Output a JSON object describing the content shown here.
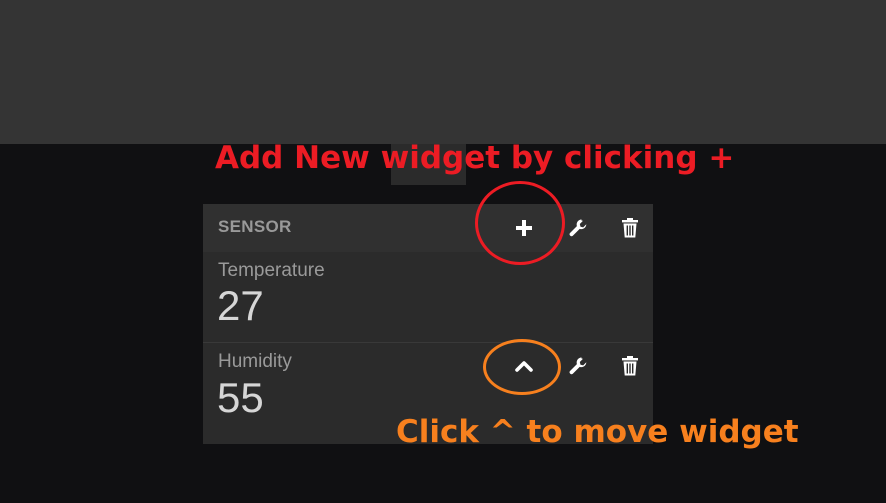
{
  "pane": {
    "title": "SENSOR",
    "header_icons": [
      "plus-icon",
      "wrench-icon",
      "trash-icon"
    ],
    "widgets": [
      {
        "label": "Temperature",
        "value": "27",
        "icons": []
      },
      {
        "label": "Humidity",
        "value": "55",
        "icons": [
          "chevron-up-icon",
          "wrench-icon",
          "trash-icon"
        ]
      }
    ]
  },
  "annotations": {
    "add_widget": "Add New widget by clicking +",
    "move_widget": "Click ^ to move widget"
  },
  "colors": {
    "annotation_red": "#ec1c24",
    "annotation_orange": "#f7801e",
    "background": "#101012",
    "header": "#343434",
    "pane": "#2b2b2b"
  }
}
